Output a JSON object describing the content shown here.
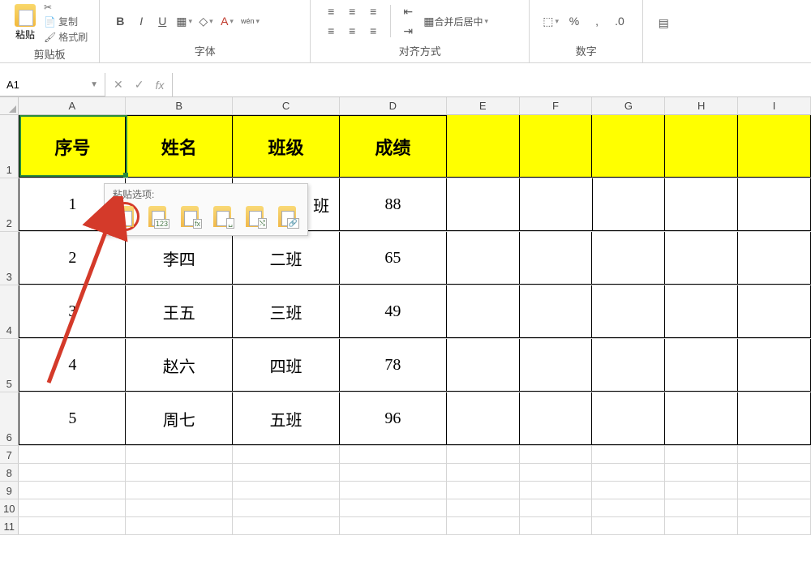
{
  "ribbon": {
    "paste_label": "粘贴",
    "copy_label": "复制",
    "format_painter_label": "格式刷",
    "clipboard_group": "剪贴板",
    "font_group": "字体",
    "align_group": "对齐方式",
    "number_group": "数字",
    "merge_center_label": "合并后居中",
    "bold": "B",
    "italic": "I",
    "underline": "U"
  },
  "namebox": {
    "value": "A1"
  },
  "fx": {
    "label": "fx"
  },
  "columns": [
    "A",
    "B",
    "C",
    "D",
    "E",
    "F",
    "G",
    "H",
    "I"
  ],
  "sheet": {
    "headers": [
      "序号",
      "姓名",
      "班级",
      "成绩"
    ],
    "rows": [
      {
        "n": "1",
        "name": "",
        "class": "班",
        "score": "88"
      },
      {
        "n": "2",
        "name": "李四",
        "class": "二班",
        "score": "65"
      },
      {
        "n": "3",
        "name": "王五",
        "class": "三班",
        "score": "49"
      },
      {
        "n": "4",
        "name": "赵六",
        "class": "四班",
        "score": "78"
      },
      {
        "n": "5",
        "name": "周七",
        "class": "五班",
        "score": "96"
      }
    ]
  },
  "paste_popup": {
    "title": "粘贴选项:",
    "options": [
      "paste",
      "values-123",
      "formulas-fx",
      "format",
      "transpose",
      "link"
    ]
  }
}
